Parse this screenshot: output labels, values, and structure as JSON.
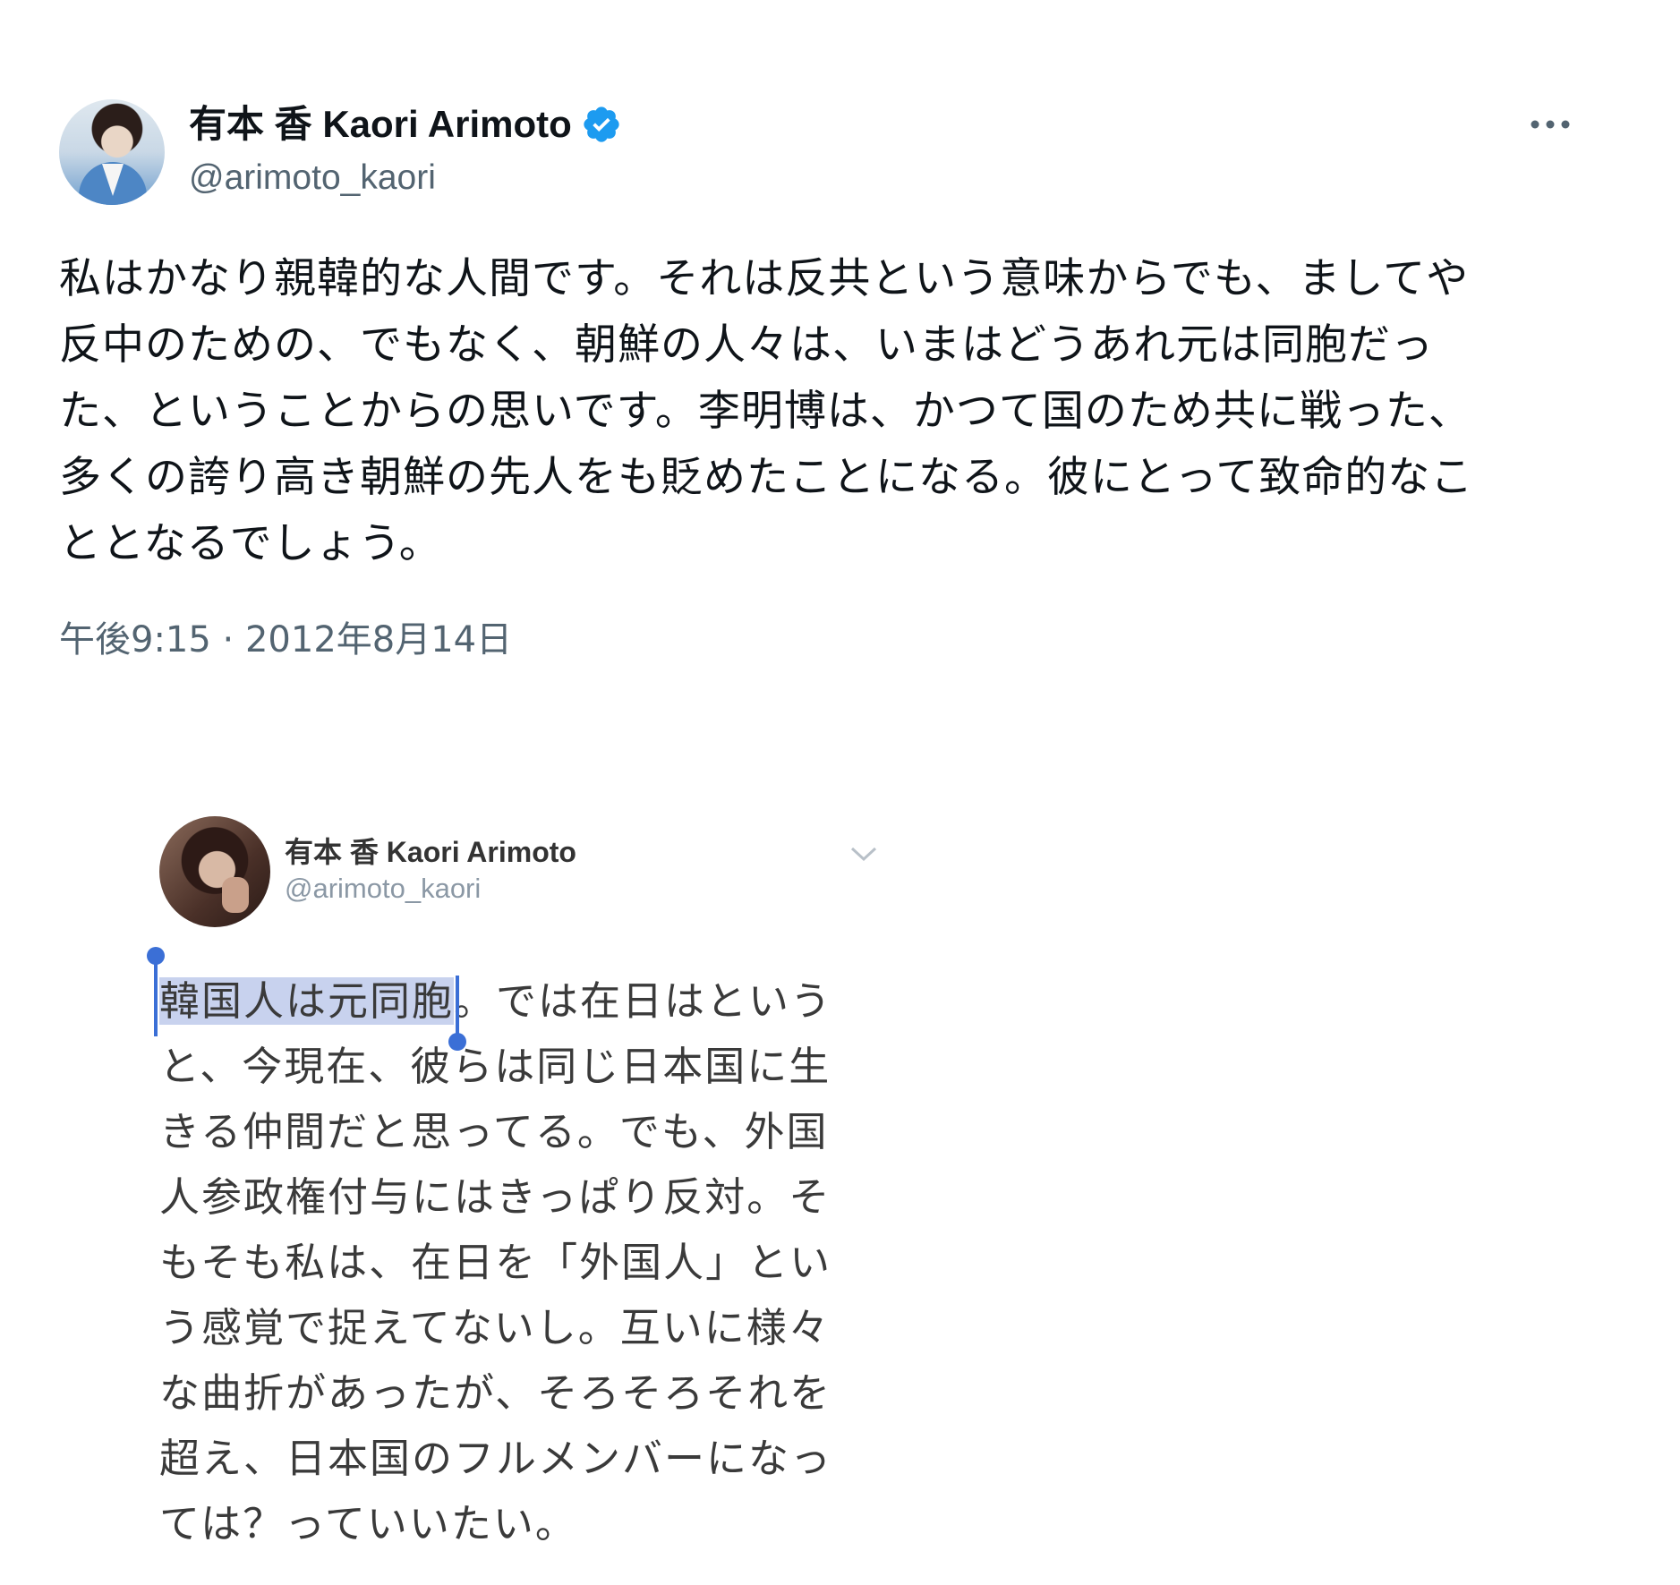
{
  "main_tweet": {
    "author_name": "有本 香 Kaori Arimoto",
    "handle": "@arimoto_kaori",
    "verified": true,
    "accent_color": "#1d9bf0",
    "text_lines": [
      "私はかなり親韓的な人間です。それは反共という意味からでも、ましてや",
      "反中のための、でもなく、朝鮮の人々は、いまはどうあれ元は同胞だっ",
      "た、ということからの思いです。李明博は、かつて国のため共に戦った、",
      "多くの誇り高き朝鮮の先人をも貶めたことになる。彼にとって致命的なこ",
      "ととなるでしょう。"
    ],
    "timestamp": "午後9:15 · 2012年8月14日",
    "more_icon": "more-horizontal-icon"
  },
  "embedded_tweet": {
    "author_name": "有本  香  Kaori Arimoto",
    "handle": "@arimoto_kaori",
    "menu_icon": "chevron-down-icon",
    "selected_text": "韓国人は元同胞",
    "selection_color": "#c8d2ee",
    "first_line_rest": "。では在日はという",
    "text_lines": [
      "と、今現在、彼らは同じ日本国に生",
      "きる仲間だと思ってる。でも、外国",
      "人参政権付与にはきっぱり反対。そ",
      "もそも私は、在日を「外国人」とい",
      "う感覚で捉えてないし。互いに様々",
      "な曲折があったが、そろそろそれを",
      "超え、日本国のフルメンバーになっ",
      "ては？っていいたい。"
    ]
  }
}
